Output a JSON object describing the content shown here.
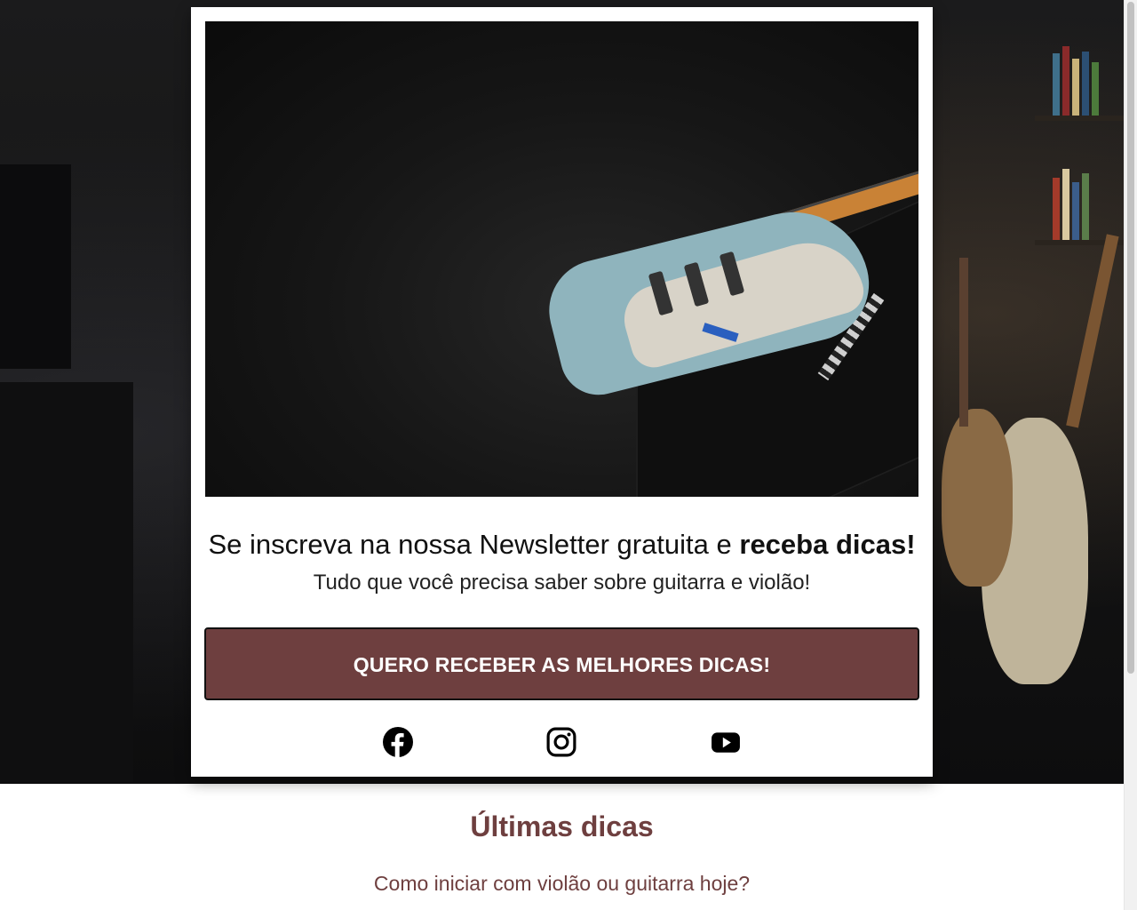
{
  "newsletter": {
    "headline_regular": "Se inscreva na nossa Newsletter gratuita e ",
    "headline_bold": "receba dicas!",
    "subheadline": "Tudo que você precisa saber sobre guitarra e violão!",
    "cta_label": "QUERO RECEBER AS MELHORES DICAS!"
  },
  "socials": [
    {
      "name": "facebook",
      "icon": "facebook-icon"
    },
    {
      "name": "instagram",
      "icon": "instagram-icon"
    },
    {
      "name": "youtube",
      "icon": "youtube-icon"
    }
  ],
  "tips": {
    "title": "Últimas dicas",
    "posts": [
      {
        "title": "Como iniciar com violão ou guitarra hoje?"
      }
    ]
  },
  "colors": {
    "accent": "#6e3f3f",
    "card_background": "#ffffff",
    "hero_background": "#141414"
  }
}
